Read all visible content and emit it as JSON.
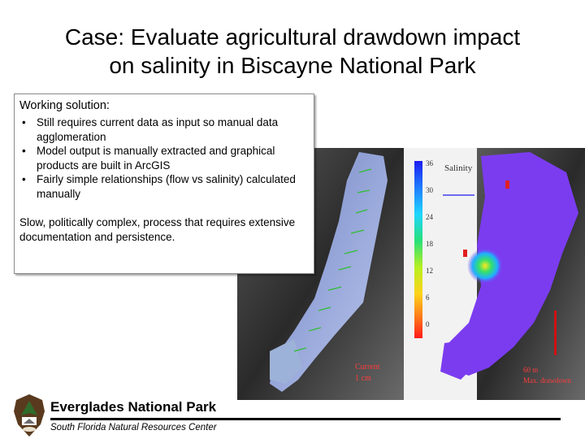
{
  "slide": {
    "title_line1": "Case: Evaluate agricultural drawdown impact",
    "title_line2": "on salinity in Biscayne National Park"
  },
  "textbox": {
    "heading": "Working solution:",
    "bullets": [
      "Still requires current data as input so manual data agglomeration",
      "Model output is manually extracted and graphical products are built in ArcGIS",
      "Fairly simple relationships (flow vs salinity) calculated manually"
    ],
    "note": "Slow, politically complex, process that requires extensive documentation and persistence."
  },
  "figure": {
    "panel_right_label": "Salinity",
    "scale_ticks": [
      "36",
      "30",
      "24",
      "18",
      "12",
      "6",
      "0"
    ],
    "scale_colors": [
      "#1c1cf0",
      "#1f7cff",
      "#1fd6ff",
      "#28e07a",
      "#b6f020",
      "#ffd21a",
      "#ff7a1a",
      "#ff1a1a"
    ],
    "left_caption_1": "Current",
    "left_caption_2": "1 cm",
    "right_caption_1": "60 m",
    "right_caption_2": "Max. drawdown"
  },
  "footer": {
    "org": "Everglades National Park",
    "subtitle": "South Florida Natural Resources Center"
  },
  "colors": {
    "rule": "#000000",
    "water": "#7b3cf0",
    "land": "#3c3c3c"
  }
}
